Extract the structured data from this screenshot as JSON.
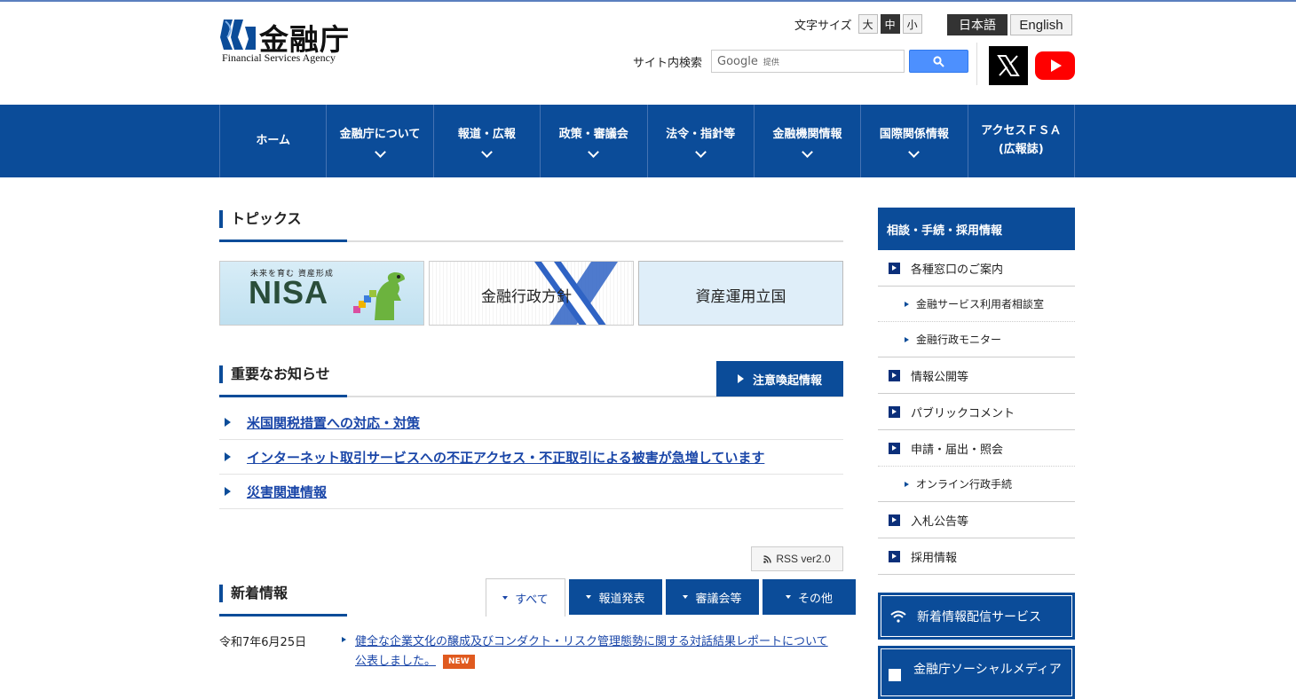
{
  "header": {
    "logo_jp": "金融庁",
    "logo_en": "Financial Services Agency",
    "font_size_label": "文字サイズ",
    "font_sizes": [
      "大",
      "中",
      "小"
    ],
    "languages": [
      "日本語",
      "English"
    ],
    "search_label": "サイト内検索",
    "search_brand": "Google",
    "search_provided": "提供"
  },
  "nav": [
    {
      "label": "ホーム",
      "has_dropdown": false
    },
    {
      "label": "金融庁について",
      "has_dropdown": true
    },
    {
      "label": "報道・広報",
      "has_dropdown": true
    },
    {
      "label": "政策・審議会",
      "has_dropdown": true
    },
    {
      "label": "法令・指針等",
      "has_dropdown": true
    },
    {
      "label": "金融機関情報",
      "has_dropdown": true
    },
    {
      "label": "国際関係情報",
      "has_dropdown": true
    },
    {
      "label": "アクセスＦＳＡ",
      "label2": "(広報誌)",
      "has_dropdown": false
    }
  ],
  "topics": {
    "title": "トピックス",
    "banners": [
      {
        "small": "未来を育む 資産形成",
        "big": "NISA"
      },
      {
        "text": "金融行政方針"
      },
      {
        "text": "資産運用立国"
      }
    ]
  },
  "important": {
    "title": "重要なお知らせ",
    "alert_button": "注意喚起情報",
    "items": [
      "米国関税措置への対応・対策",
      "インターネット取引サービスへの不正アクセス・不正取引による被害が急増しています",
      "災害関連情報"
    ]
  },
  "rss_label": "RSS ver2.0",
  "news": {
    "title": "新着情報",
    "tabs": [
      "すべて",
      "報道発表",
      "審議会等",
      "その他"
    ],
    "items": [
      {
        "date": "令和7年6月25日",
        "text": "健全な企業文化の醸成及びコンダクト・リスク管理態勢に関する対話結果レポートについて公表しました。",
        "badge": "NEW"
      }
    ]
  },
  "sidebar": {
    "title": "相談・手続・採用情報",
    "items": [
      {
        "label": "各種窓口のご案内",
        "sub": false
      },
      {
        "label": "金融サービス利用者相談室",
        "sub": true
      },
      {
        "label": "金融行政モニター",
        "sub": true
      },
      {
        "label": "情報公開等",
        "sub": false
      },
      {
        "label": "パブリックコメント",
        "sub": false
      },
      {
        "label": "申請・届出・照会",
        "sub": false
      },
      {
        "label": "オンライン行政手続",
        "sub": true
      },
      {
        "label": "入札公告等",
        "sub": false
      },
      {
        "label": "採用情報",
        "sub": false
      }
    ],
    "service_button": "新着情報配信サービス",
    "social_button": "金融庁ソーシャルメディア"
  },
  "colors": {
    "brand": "#0b4c99",
    "link": "#1a46a8",
    "new_badge": "#e05a1f"
  }
}
